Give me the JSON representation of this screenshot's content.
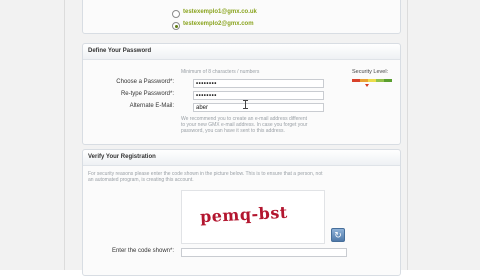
{
  "email_options": [
    {
      "label": "testexemplo1@gmx.co.uk",
      "selected": false
    },
    {
      "label": "testexemplo2@gmx.com",
      "selected": true
    }
  ],
  "password_section": {
    "title": "Define Your Password",
    "hint": "Minimum of 8 characters / numbers",
    "choose_label": "Choose a Password*:",
    "choose_value": "••••••••",
    "retype_label": "Re-type Password*:",
    "retype_value": "••••••••",
    "alt_email_label": "Alternate E-Mail:",
    "alt_email_value": "aber",
    "alt_email_note_1": "We recommend you to create an e-mail address different",
    "alt_email_note_2": "to your new GMX e-mail address. In case you forget your",
    "alt_email_note_3": "password, you can have it sent to this address.",
    "security_title": "Security Level:",
    "security_colors": [
      "#d8412a",
      "#e9a233",
      "#ecdd4b",
      "#93c24a",
      "#5a9e2f"
    ],
    "security_level": 0.2
  },
  "verify_section": {
    "title": "Verify Your Registration",
    "text_1": "For security reasons please enter the code shown in the picture below. This is to ensure that a person, not",
    "text_2": "an automated program, is creating this account.",
    "captcha_text": "pemq-bst",
    "code_label": "Enter the code shown*:",
    "code_value": ""
  },
  "icons": {
    "refresh": "refresh-icon"
  }
}
